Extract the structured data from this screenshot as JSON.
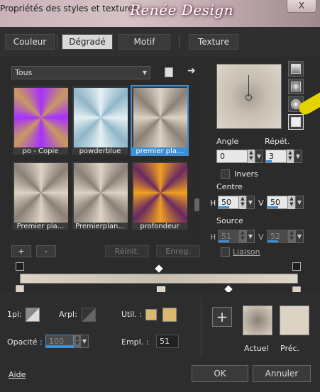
{
  "window": {
    "title": "Propriétés des styles et textures",
    "brand": "Renée Design",
    "close_label": "X"
  },
  "tabs": [
    {
      "label": "Couleur"
    },
    {
      "label": "Dégradé"
    },
    {
      "label": "Motif"
    },
    {
      "label": "Texture"
    }
  ],
  "active_tab": "Dégradé",
  "preset_select": {
    "value": "Tous"
  },
  "presets": [
    {
      "label": "po - Copie",
      "colors": [
        "#a630ff",
        "#c89a60"
      ]
    },
    {
      "label": "powderblue",
      "colors": [
        "#e6f0f4",
        "#8fb6c7"
      ]
    },
    {
      "label": "premier pla...",
      "colors": [
        "#ddd3c4",
        "#8a8076"
      ]
    },
    {
      "label": "Premier pla...",
      "colors": [
        "#ddd3c4",
        "#8a8076"
      ]
    },
    {
      "label": "Premierplan...",
      "colors": [
        "#ddd3c4",
        "#8a8076"
      ]
    },
    {
      "label": "profondeur",
      "colors": [
        "#f0a020",
        "#6a2a60"
      ]
    }
  ],
  "selected_preset": "premier pla...",
  "list_buttons": {
    "add": "+",
    "remove": "-",
    "reset": "Réinit.",
    "save": "Enreg."
  },
  "properties": {
    "angle_label": "Angle",
    "angle_value": "0",
    "repeat_label": "Répét.",
    "repeat_value": "3",
    "invert_label": "Invers",
    "center_label": "Centre",
    "center_h_label": "H",
    "center_h": "50",
    "center_v_label": "V",
    "center_v": "50",
    "source_label": "Source",
    "source_h_label": "H",
    "source_h": "51",
    "source_v_label": "V",
    "source_v": "52",
    "link_label": "Liaison"
  },
  "stop_controls": {
    "mode_label": "1pl:",
    "arpl_label": "Arpl:",
    "util_label": "Util. :",
    "opacity_label": "Opacité :",
    "opacity_value": "100",
    "location_label": "Empl. :",
    "location_value": "51"
  },
  "colors": {
    "stop_color": "#d9b870",
    "accent": "#3c8fd4",
    "gradient_light": "#ddd3c4",
    "gradient_dark": "#a59d94"
  },
  "comparison": {
    "current_label": "Actuel",
    "previous_label": "Préc."
  },
  "footer": {
    "help": "Aide",
    "ok": "OK",
    "cancel": "Annuler"
  },
  "icons": [
    "arrow-right-icon",
    "chevron-down-icon",
    "book-icon",
    "plus-icon"
  ]
}
